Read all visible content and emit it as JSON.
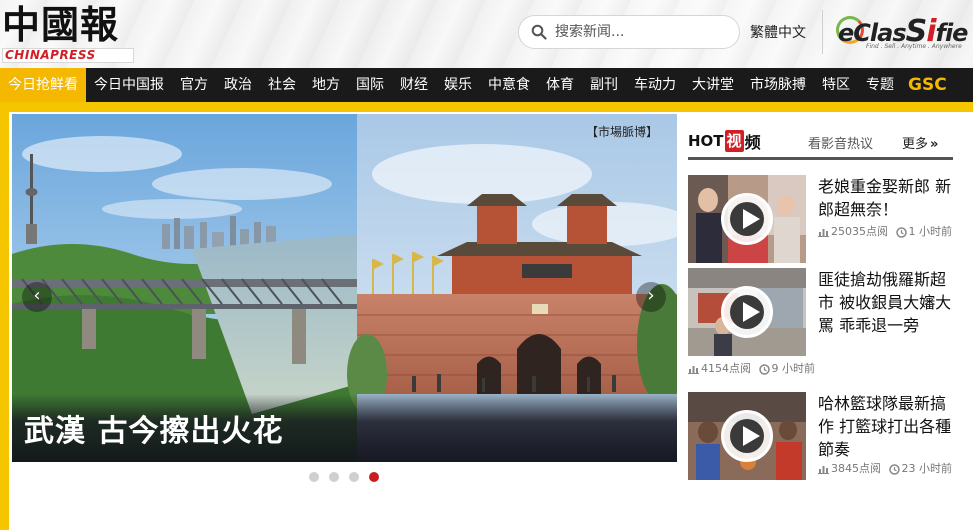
{
  "header": {
    "logo_cn": "中國報",
    "logo_en": "CHINAPRESS",
    "search_placeholder": "搜索新闻...",
    "language_link": "繁體中文",
    "eclassified": {
      "word_a": "eClas",
      "word_b": "S",
      "word_c": "i",
      "word_d": "fie",
      "tagline": "Find . Sell . Anytime . Anywhere"
    }
  },
  "nav": {
    "items": [
      {
        "label": "今日抢鲜看",
        "active": true
      },
      {
        "label": "今日中国报"
      },
      {
        "label": "官方"
      },
      {
        "label": "政治"
      },
      {
        "label": "社会"
      },
      {
        "label": "地方"
      },
      {
        "label": "国际"
      },
      {
        "label": "财经"
      },
      {
        "label": "娱乐"
      },
      {
        "label": "中意食"
      },
      {
        "label": "体育"
      },
      {
        "label": "副刊"
      },
      {
        "label": "车动力"
      },
      {
        "label": "大讲堂"
      },
      {
        "label": "市场脉搏"
      },
      {
        "label": "特区"
      },
      {
        "label": "专题"
      }
    ],
    "gsc_label": "GSC"
  },
  "slider": {
    "caption": "武漢 古今擦出火花",
    "tag": "【市場脈博】",
    "prev_arrow": "‹",
    "next_arrow": "›",
    "slide_count": 4,
    "active_slide": 4
  },
  "hot_videos": {
    "logo_hot": "HOT",
    "logo_shi": "视",
    "logo_pin": "频",
    "description": "看影音热议",
    "more_label": "更多",
    "more_chevron": "»",
    "items": [
      {
        "title": "老娘重金娶新郎 新郎超無奈！",
        "views": "25035点阅",
        "time": "1 小时前"
      },
      {
        "title": "匪徒搶劫俄羅斯超市 被收銀員大嬸大罵 乖乖退一旁",
        "views": "4154点阅",
        "time": "9 小时前"
      },
      {
        "title": "哈林籃球隊最新搞作 打籃球打出各種節奏",
        "views": "3845点阅",
        "time": "23 小时前"
      }
    ]
  },
  "colors": {
    "accent_yellow": "#f5c500",
    "nav_bg": "#1a1a1a",
    "active_dot": "#c81e1e",
    "brand_red": "#d21f26"
  }
}
